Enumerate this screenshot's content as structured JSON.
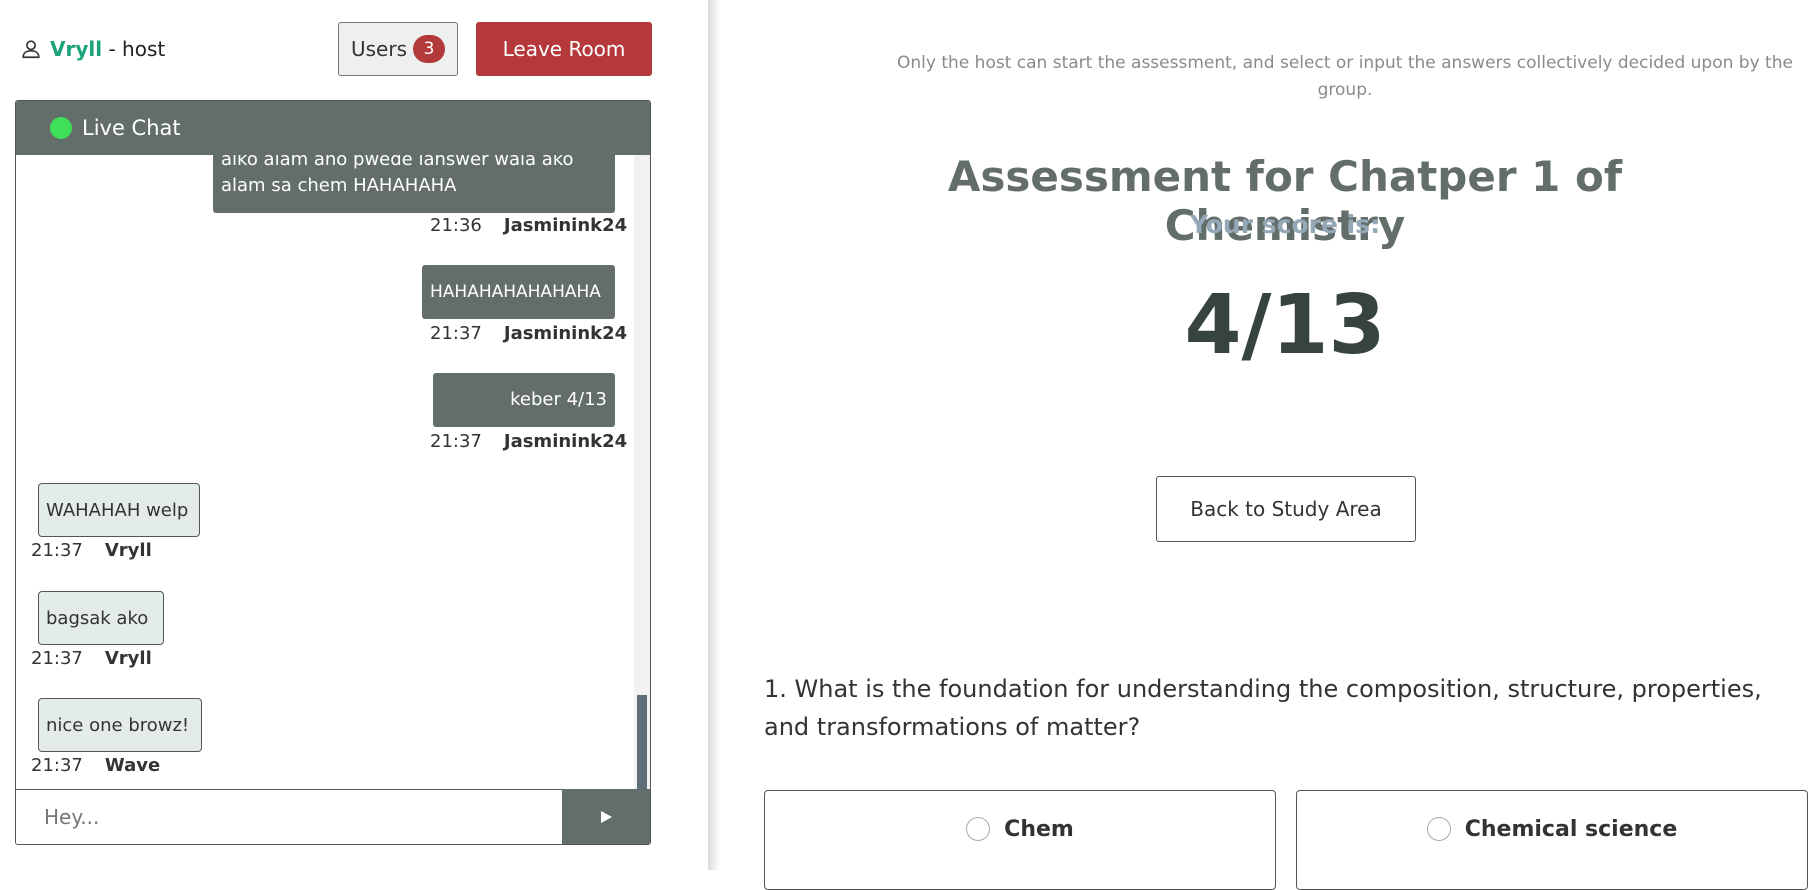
{
  "header": {
    "user_name": "Vryll",
    "user_role": " - host",
    "users_label": "Users",
    "users_count": "3",
    "leave_label": "Leave Room"
  },
  "chat": {
    "title": "Live Chat",
    "messages": [
      {
        "text": "aiko alam ano pwede ianswer wala ako alam sa chem HAHAHAHA",
        "time": "21:36",
        "user": "Jasminink24"
      },
      {
        "text": "HAHAHAHAHAHAHA",
        "time": "21:37",
        "user": "Jasminink24"
      },
      {
        "text": "keber 4/13",
        "time": "21:37",
        "user": "Jasminink24"
      },
      {
        "text": "WAHAHAH welp",
        "time": "21:37",
        "user": "Vryll"
      },
      {
        "text": "bagsak ako",
        "time": "21:37",
        "user": "Vryll"
      },
      {
        "text": "nice one browz!",
        "time": "21:37",
        "user": "Wave"
      }
    ],
    "input_placeholder": "Hey...",
    "send_icon": "play-icon"
  },
  "main": {
    "notice": "Only the host can start the assessment, and select or input the answers collectively decided upon by the group.",
    "title": "Assessment for Chatper 1 of Chemistry",
    "score_label": "Your score is:",
    "score": "4/13",
    "back_label": "Back to Study Area",
    "question": "1. What is the foundation for understanding the composition, structure, properties, and transformations of matter?",
    "options": [
      "Chem",
      "Chemical science"
    ]
  },
  "colors": {
    "accent_green": "#1aa37a",
    "danger_red": "#b5393b",
    "chat_gray": "#636e6b",
    "live_dot": "#3ee05a",
    "score_label": "#94a8b8"
  }
}
